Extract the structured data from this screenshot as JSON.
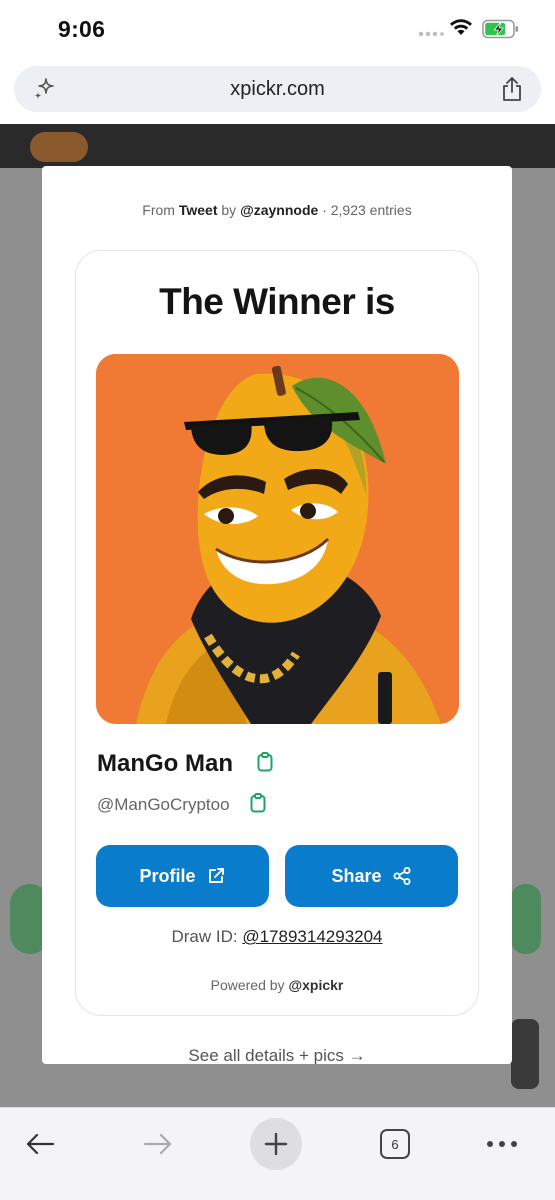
{
  "status_bar": {
    "time": "9:06",
    "icons": [
      "cellular-dots-icon",
      "wifi-icon",
      "battery-charging-icon"
    ]
  },
  "browser": {
    "url": "xpickr.com",
    "tab_count": "6"
  },
  "modal": {
    "source": {
      "prefix": "From",
      "type": "Tweet",
      "by_word": "by",
      "author": "@zaynnode",
      "separator": "·",
      "entries": "2,923 entries"
    },
    "headline": "The Winner is",
    "winner": {
      "name": "ManGo Man",
      "handle": "@ManGoCryptoo"
    },
    "buttons": {
      "profile_label": "Profile",
      "share_label": "Share"
    },
    "draw": {
      "label": "Draw ID:",
      "id": "@1789314293204"
    },
    "powered": {
      "prefix": "Powered by",
      "brand": "@xpickr"
    },
    "see_all": "See all details + pics →"
  },
  "colors": {
    "accent_blue": "#0a7ccc",
    "copy_icon_green": "#1fa36a",
    "avatar_bg_orange": "#f07a33"
  }
}
